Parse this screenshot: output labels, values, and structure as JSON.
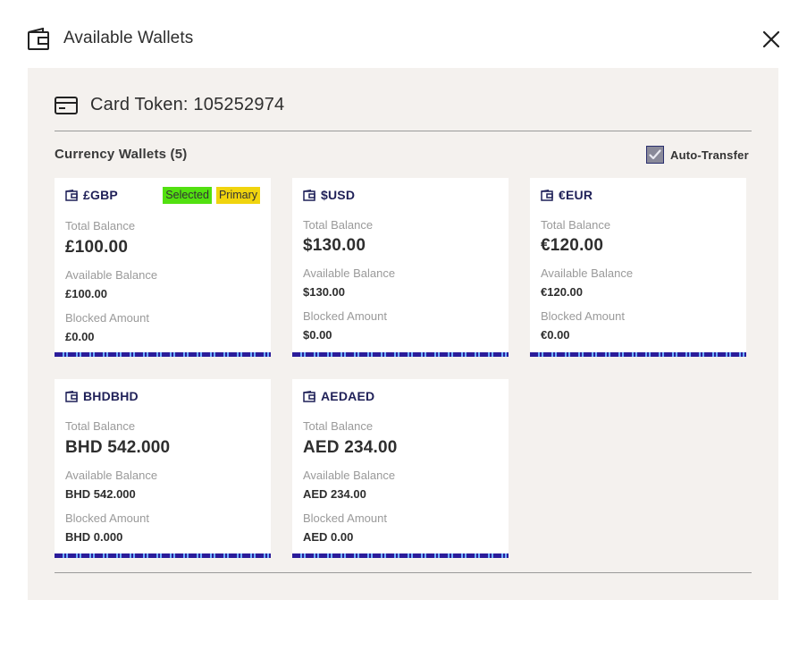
{
  "header": {
    "title": "Available Wallets",
    "icon": "wallet-icon",
    "close_icon": "close-icon"
  },
  "panel": {
    "card_token": "Card Token: 105252974",
    "token_icon": "credit-card-icon",
    "wallets_heading": "Currency Wallets (5)",
    "auto_transfer": {
      "label": "Auto-Transfer",
      "checked": true
    }
  },
  "labels": {
    "total_balance": "Total Balance",
    "available_balance": "Available Balance",
    "blocked_amount": "Blocked Amount"
  },
  "wallets": [
    {
      "currency": "£GBP",
      "total": "£100.00",
      "available": "£100.00",
      "blocked": "£0.00",
      "badges": [
        "Selected",
        "Primary"
      ]
    },
    {
      "currency": "$USD",
      "total": "$130.00",
      "available": "$130.00",
      "blocked": "$0.00",
      "badges": []
    },
    {
      "currency": "€EUR",
      "total": "€120.00",
      "available": "€120.00",
      "blocked": "€0.00",
      "badges": []
    },
    {
      "currency": "BHDBHD",
      "total": "BHD 542.000",
      "available": "BHD 542.000",
      "blocked": "BHD 0.000",
      "badges": []
    },
    {
      "currency": "AEDAED",
      "total": "AED 234.00",
      "available": "AED 234.00",
      "blocked": "AED 0.00",
      "badges": []
    }
  ],
  "colors": {
    "currency_text": "#1f2058",
    "selected_badge": "#52e010",
    "primary_badge": "#f0d40e",
    "panel_bg": "#f4f1ee",
    "stripe_dark": "#2b1c9a",
    "stripe_light": "#6fb0ff"
  }
}
